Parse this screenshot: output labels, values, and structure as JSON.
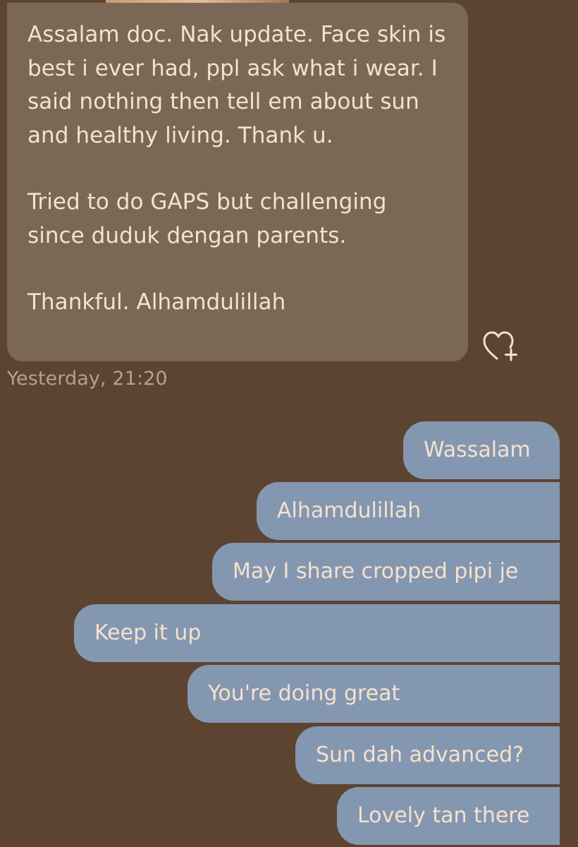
{
  "incoming_message": {
    "paragraph_1": "Assalam doc. Nak update. Face skin is best i ever had, ppl ask what i wear. I said nothing then tell em about sun and healthy living. Thank u.",
    "paragraph_2": "Tried to do GAPS but challenging since duduk dengan parents.",
    "paragraph_3": "Thankful. Alhamdulillah",
    "reaction_icon": "heart-plus-icon",
    "timestamp": "Yesterday, 21:20"
  },
  "outgoing_messages": [
    "Wassalam",
    "Alhamdulillah",
    "May I share cropped pipi je",
    "Keep it up",
    "You're doing great",
    "Sun dah advanced?",
    "Lovely tan there"
  ],
  "colors": {
    "background": "#5c4431",
    "incoming_bubble": "#7a6756",
    "outgoing_bubble": "#8497b1",
    "text": "#f7e1cb",
    "timestamp": "#b8a08b"
  }
}
